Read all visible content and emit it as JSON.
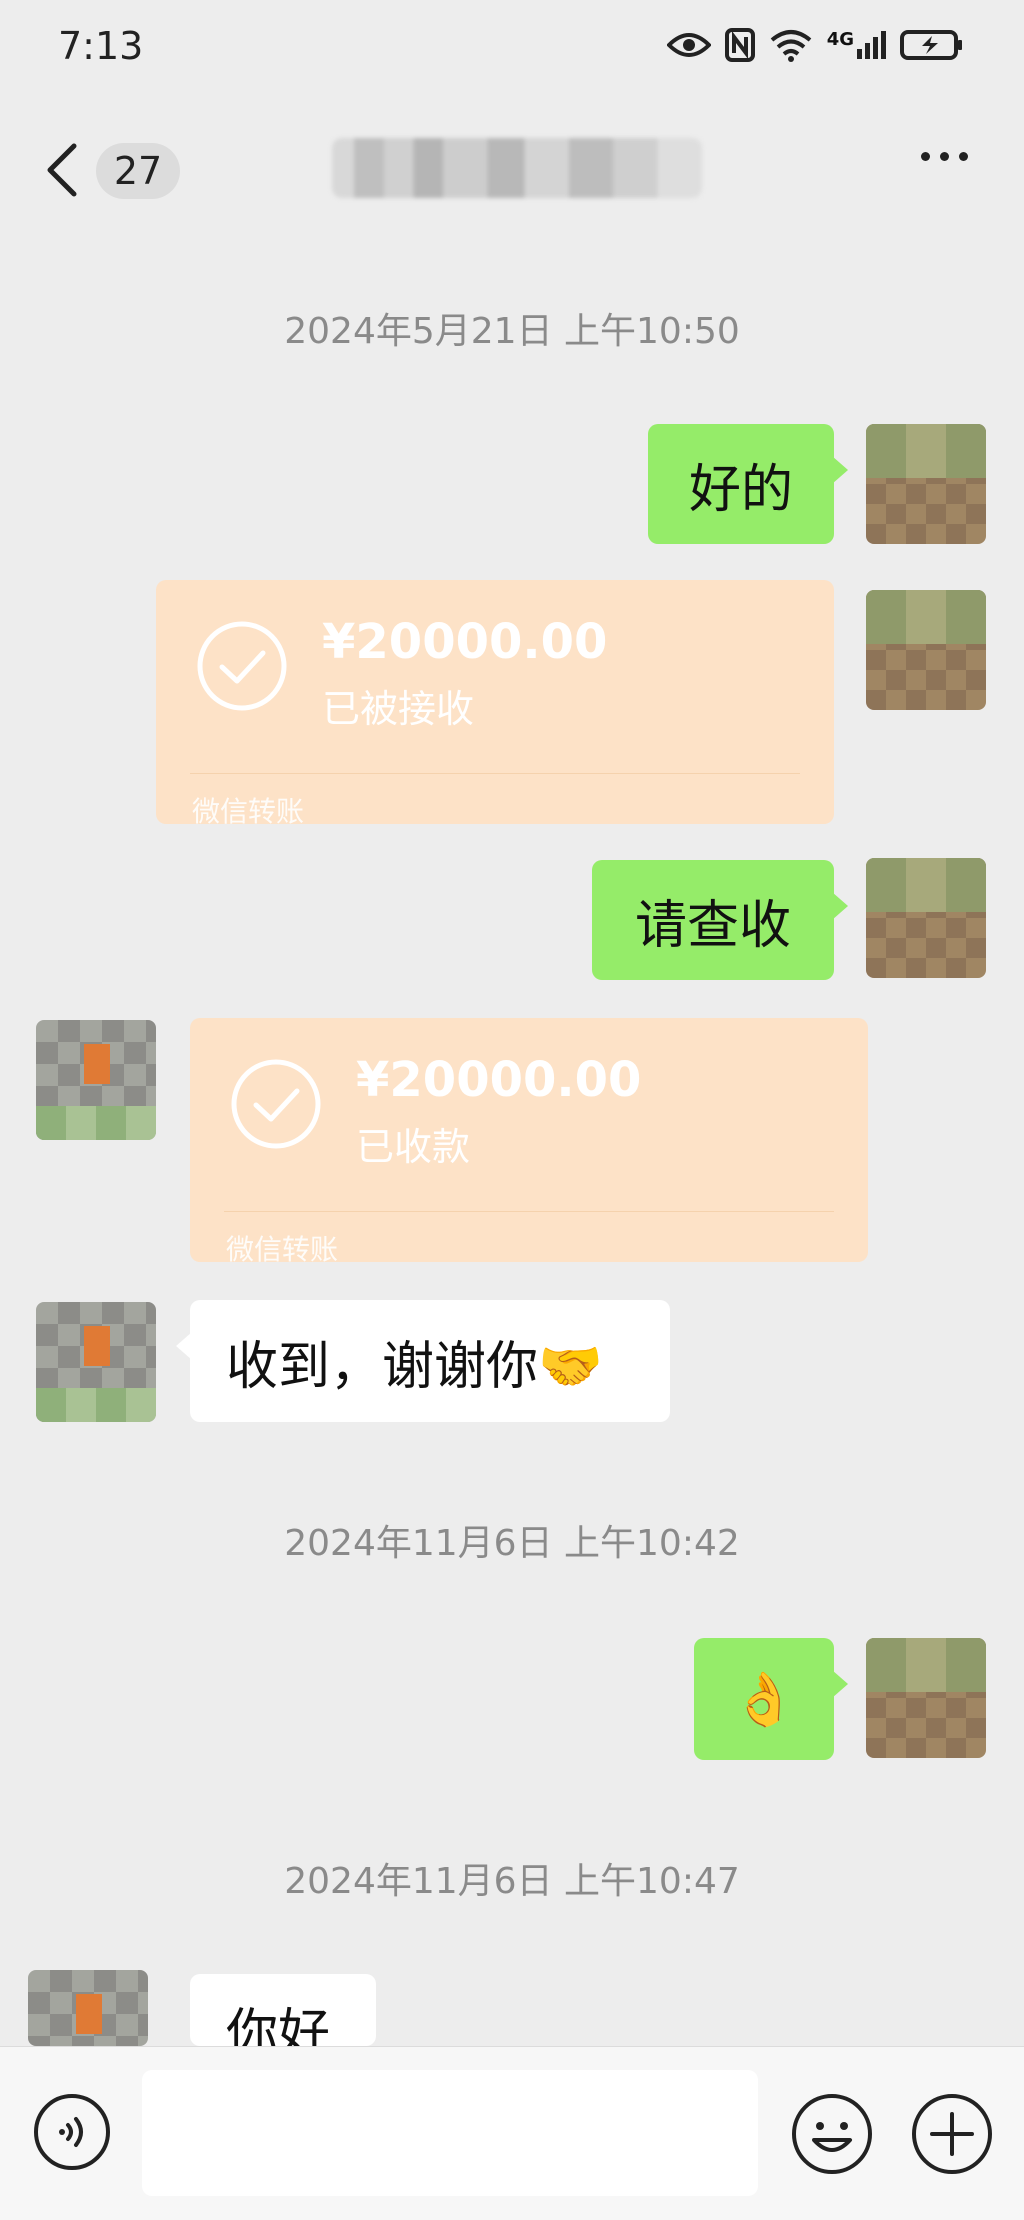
{
  "status_bar": {
    "time": "7:13",
    "icons": [
      "eye-icon",
      "nfc-icon",
      "wifi-icon",
      "signal-4g-icon",
      "battery-charging-icon"
    ],
    "signal_label": "4G"
  },
  "header": {
    "unread_count": "27",
    "title": "",
    "more_icon": "more-dots-icon"
  },
  "timestamps": {
    "t1": "2024年5月21日 上午10:50",
    "t2": "2024年11月6日 上午10:42",
    "t3": "2024年11月6日 上午10:47"
  },
  "messages": {
    "m1_text": "好的",
    "transfer1": {
      "amount": "¥20000.00",
      "status": "已被接收",
      "footer": "微信转账"
    },
    "m2_text": "请查收",
    "transfer2": {
      "amount": "¥20000.00",
      "status": "已收款",
      "footer": "微信转账"
    },
    "m3_text": "收到，谢谢你🤝",
    "m4_text": "👌",
    "m5_text": "你好"
  },
  "input_bar": {
    "voice_icon": "voice-icon",
    "emoji_icon": "emoji-icon",
    "plus_icon": "plus-icon",
    "placeholder": ""
  },
  "colors": {
    "background": "#ededed",
    "sent_bubble": "#95ec69",
    "received_bubble": "#ffffff",
    "transfer_card": "#fde2c7",
    "timestamp_text": "#8a8a8a"
  }
}
